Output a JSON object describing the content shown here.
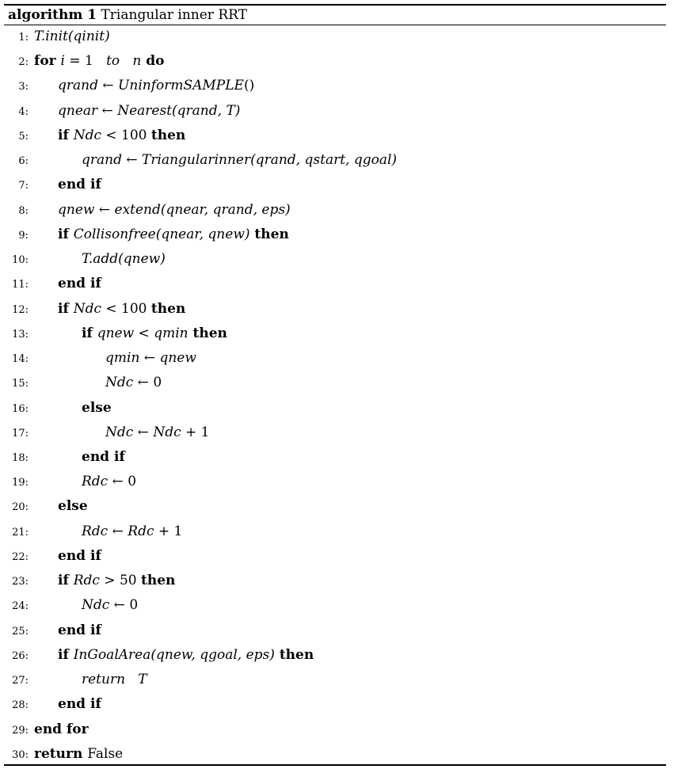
{
  "caption": {
    "label": "algorithm 1",
    "title": "Triangular inner RRT"
  },
  "lines": [
    {
      "num": "1:",
      "indent": 0,
      "segs": [
        {
          "t": "math",
          "v": "T.init(qinit)"
        }
      ]
    },
    {
      "num": "2:",
      "indent": 0,
      "segs": [
        {
          "t": "kw",
          "v": "for "
        },
        {
          "t": "math",
          "v": "i"
        },
        {
          "t": "plain",
          "v": " = 1   "
        },
        {
          "t": "math",
          "v": "to"
        },
        {
          "t": "plain",
          "v": "   "
        },
        {
          "t": "math",
          "v": "n"
        },
        {
          "t": "kw",
          "v": " do"
        }
      ]
    },
    {
      "num": "3:",
      "indent": 1,
      "segs": [
        {
          "t": "math",
          "v": "qrand"
        },
        {
          "t": "plain",
          "v": " ← "
        },
        {
          "t": "math",
          "v": "UninformSAMPLE"
        },
        {
          "t": "plain",
          "v": "()"
        }
      ]
    },
    {
      "num": "4:",
      "indent": 1,
      "segs": [
        {
          "t": "math",
          "v": "qnear"
        },
        {
          "t": "plain",
          "v": " ← "
        },
        {
          "t": "math",
          "v": "Nearest(qrand, T)"
        }
      ]
    },
    {
      "num": "5:",
      "indent": 1,
      "segs": [
        {
          "t": "kw",
          "v": "if "
        },
        {
          "t": "math",
          "v": "Ndc"
        },
        {
          "t": "plain",
          "v": " < 100 "
        },
        {
          "t": "kw",
          "v": "then"
        }
      ]
    },
    {
      "num": "6:",
      "indent": 2,
      "segs": [
        {
          "t": "math",
          "v": "qrand"
        },
        {
          "t": "plain",
          "v": " ← "
        },
        {
          "t": "math",
          "v": "Triangularinner(qrand, qstart, qgoal)"
        }
      ]
    },
    {
      "num": "7:",
      "indent": 1,
      "segs": [
        {
          "t": "kw",
          "v": "end if"
        }
      ]
    },
    {
      "num": "8:",
      "indent": 1,
      "segs": [
        {
          "t": "math",
          "v": "qnew"
        },
        {
          "t": "plain",
          "v": " ← "
        },
        {
          "t": "math",
          "v": "extend(qnear, qrand, eps)"
        }
      ]
    },
    {
      "num": "9:",
      "indent": 1,
      "segs": [
        {
          "t": "kw",
          "v": "if "
        },
        {
          "t": "math",
          "v": "Collisonfree(qnear, qnew)"
        },
        {
          "t": "kw",
          "v": " then"
        }
      ]
    },
    {
      "num": "10:",
      "indent": 2,
      "segs": [
        {
          "t": "math",
          "v": "T.add(qnew)"
        }
      ]
    },
    {
      "num": "11:",
      "indent": 1,
      "segs": [
        {
          "t": "kw",
          "v": "end if"
        }
      ]
    },
    {
      "num": "12:",
      "indent": 1,
      "segs": [
        {
          "t": "kw",
          "v": "if "
        },
        {
          "t": "math",
          "v": "Ndc"
        },
        {
          "t": "plain",
          "v": " < 100 "
        },
        {
          "t": "kw",
          "v": "then"
        }
      ]
    },
    {
      "num": "13:",
      "indent": 2,
      "segs": [
        {
          "t": "kw",
          "v": "if "
        },
        {
          "t": "math",
          "v": "qnew"
        },
        {
          "t": "plain",
          "v": " < "
        },
        {
          "t": "math",
          "v": "qmin"
        },
        {
          "t": "kw",
          "v": " then"
        }
      ]
    },
    {
      "num": "14:",
      "indent": 3,
      "segs": [
        {
          "t": "math",
          "v": "qmin"
        },
        {
          "t": "plain",
          "v": " ← "
        },
        {
          "t": "math",
          "v": "qnew"
        }
      ]
    },
    {
      "num": "15:",
      "indent": 3,
      "segs": [
        {
          "t": "math",
          "v": "Ndc"
        },
        {
          "t": "plain",
          "v": " ← 0"
        }
      ]
    },
    {
      "num": "16:",
      "indent": 2,
      "segs": [
        {
          "t": "kw",
          "v": "else"
        }
      ]
    },
    {
      "num": "17:",
      "indent": 3,
      "segs": [
        {
          "t": "math",
          "v": "Ndc"
        },
        {
          "t": "plain",
          "v": " ← "
        },
        {
          "t": "math",
          "v": "Ndc"
        },
        {
          "t": "plain",
          "v": " + 1"
        }
      ]
    },
    {
      "num": "18:",
      "indent": 2,
      "segs": [
        {
          "t": "kw",
          "v": "end if"
        }
      ]
    },
    {
      "num": "19:",
      "indent": 2,
      "segs": [
        {
          "t": "math",
          "v": "Rdc"
        },
        {
          "t": "plain",
          "v": " ← 0"
        }
      ]
    },
    {
      "num": "20:",
      "indent": 1,
      "segs": [
        {
          "t": "kw",
          "v": "else"
        }
      ]
    },
    {
      "num": "21:",
      "indent": 2,
      "segs": [
        {
          "t": "math",
          "v": "Rdc"
        },
        {
          "t": "plain",
          "v": " ← "
        },
        {
          "t": "math",
          "v": "Rdc"
        },
        {
          "t": "plain",
          "v": " + 1"
        }
      ]
    },
    {
      "num": "22:",
      "indent": 1,
      "segs": [
        {
          "t": "kw",
          "v": "end if"
        }
      ]
    },
    {
      "num": "23:",
      "indent": 1,
      "segs": [
        {
          "t": "kw",
          "v": "if "
        },
        {
          "t": "math",
          "v": "Rdc"
        },
        {
          "t": "plain",
          "v": " > 50 "
        },
        {
          "t": "kw",
          "v": "then"
        }
      ]
    },
    {
      "num": "24:",
      "indent": 2,
      "segs": [
        {
          "t": "math",
          "v": "Ndc"
        },
        {
          "t": "plain",
          "v": " ← 0"
        }
      ]
    },
    {
      "num": "25:",
      "indent": 1,
      "segs": [
        {
          "t": "kw",
          "v": "end if"
        }
      ]
    },
    {
      "num": "26:",
      "indent": 1,
      "segs": [
        {
          "t": "kw",
          "v": "if "
        },
        {
          "t": "math",
          "v": "InGoalArea(qnew, qgoal, eps)"
        },
        {
          "t": "kw",
          "v": " then"
        }
      ]
    },
    {
      "num": "27:",
      "indent": 2,
      "segs": [
        {
          "t": "math",
          "v": "return"
        },
        {
          "t": "plain",
          "v": "   "
        },
        {
          "t": "math",
          "v": "T"
        }
      ]
    },
    {
      "num": "28:",
      "indent": 1,
      "segs": [
        {
          "t": "kw",
          "v": "end if"
        }
      ]
    },
    {
      "num": "29:",
      "indent": 0,
      "segs": [
        {
          "t": "kw",
          "v": "end for"
        }
      ]
    },
    {
      "num": "30:",
      "indent": 0,
      "segs": [
        {
          "t": "kw",
          "v": "return "
        },
        {
          "t": "plain",
          "v": "False"
        }
      ]
    }
  ]
}
